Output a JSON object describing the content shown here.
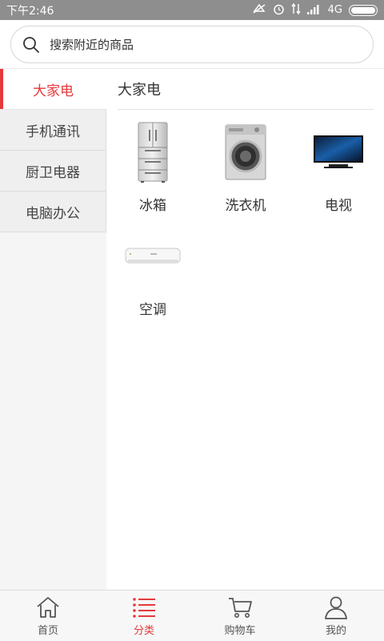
{
  "status_bar": {
    "time": "下午2:46",
    "network": "4G"
  },
  "search": {
    "placeholder": "搜索附近的商品"
  },
  "sidebar": {
    "items": [
      {
        "label": "大家电",
        "active": true
      },
      {
        "label": "手机通讯",
        "active": false
      },
      {
        "label": "厨卫电器",
        "active": false
      },
      {
        "label": "电脑办公",
        "active": false
      }
    ]
  },
  "main": {
    "section_title": "大家电",
    "products": [
      {
        "label": "冰箱",
        "icon": "fridge-icon"
      },
      {
        "label": "洗衣机",
        "icon": "washing-machine-icon"
      },
      {
        "label": "电视",
        "icon": "tv-icon"
      },
      {
        "label": "空调",
        "icon": "air-conditioner-icon"
      }
    ]
  },
  "bottom_nav": {
    "items": [
      {
        "label": "首页",
        "icon": "home-icon",
        "active": false
      },
      {
        "label": "分类",
        "icon": "category-list-icon",
        "active": true
      },
      {
        "label": "购物车",
        "icon": "cart-icon",
        "active": false
      },
      {
        "label": "我的",
        "icon": "user-icon",
        "active": false
      }
    ]
  },
  "colors": {
    "accent": "#e4393c",
    "status_bar": "#8e8e8e"
  }
}
